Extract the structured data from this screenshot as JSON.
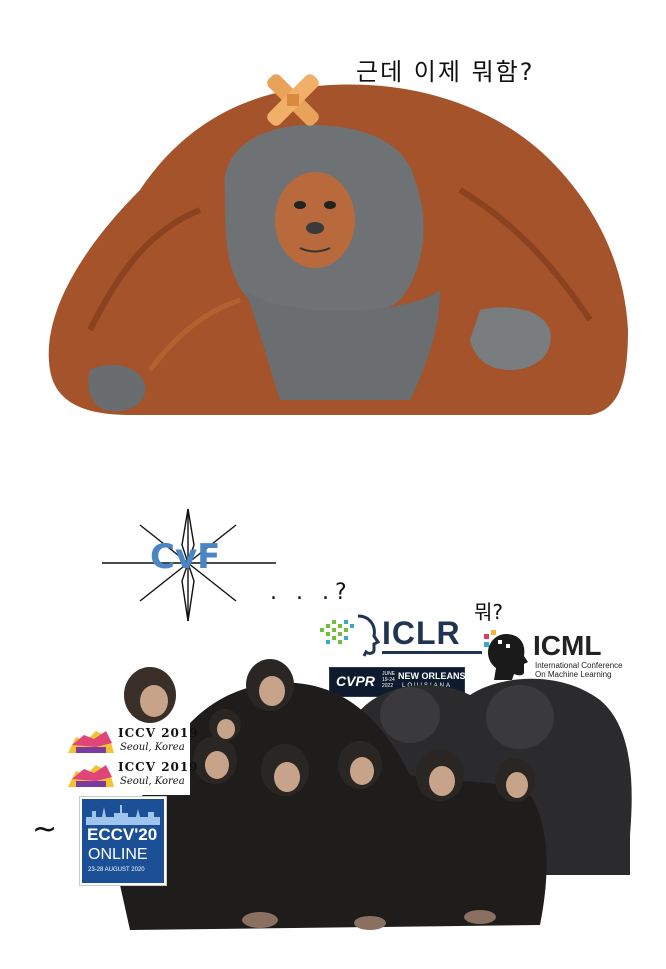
{
  "top_panel": {
    "caption": "근데 이제 뭐함?"
  },
  "bottom_panel": {
    "cvf_logo": {
      "text": "CvF"
    },
    "dots_question": ". . .?",
    "what_question": "뭐?",
    "iclr": {
      "text": "ICLR"
    },
    "icml": {
      "text": "ICML",
      "subtitle_line1": "International Conference",
      "subtitle_line2": "On Machine Learning"
    },
    "cvpr": {
      "logo": "CVPR",
      "dates": "JUNE 19-24 2022",
      "city": "NEW ORLEANS",
      "state": "LOUISIANA"
    },
    "iccv_badges": [
      {
        "name": "ICCV 2019",
        "location": "Seoul, Korea"
      },
      {
        "name": "ICCV 2019",
        "location": "Seoul, Korea"
      }
    ],
    "eccv": {
      "title": "ECCV'20",
      "subtitle": "ONLINE",
      "dates": "23-28 AUGUST 2020"
    },
    "tilde_mark": "~"
  },
  "colors": {
    "orangutan_fur": "#a4532a",
    "orangutan_face": "#6f7275",
    "bandage": "#e8a25a",
    "cvf_blue": "#4a86c5",
    "iclr_navy": "#1f3552",
    "cvpr_bg": "#0e1a2e",
    "eccv_blue": "#1b4f96",
    "iccv_pink": "#e0457a",
    "iccv_yellow": "#f2c230"
  }
}
